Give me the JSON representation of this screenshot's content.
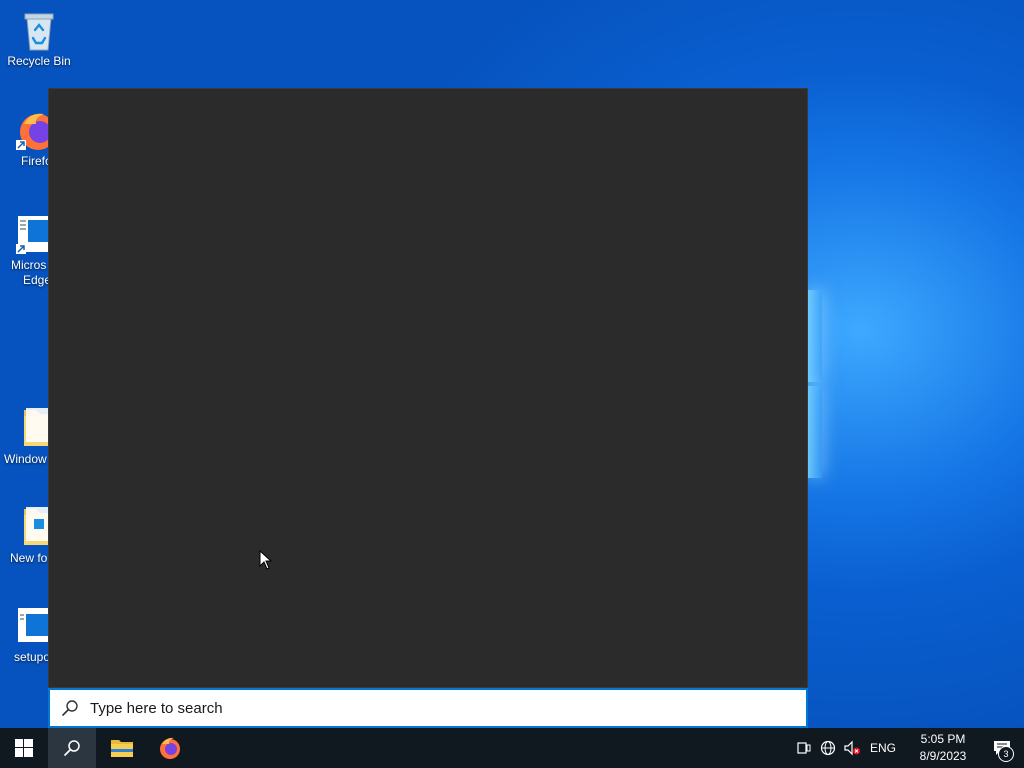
{
  "desktop": {
    "icons": [
      {
        "label": "Recycle Bin",
        "icon": "recycle-bin-icon"
      },
      {
        "label": "Firefo",
        "icon": "firefox-icon"
      },
      {
        "label": "Micros\nEdge",
        "line1": "Micros",
        "line2": "Edge",
        "icon": "edge-shortcut-icon"
      },
      {
        "label": "Window",
        "icon": "folder-icon"
      },
      {
        "label": "New fo",
        "icon": "folder-icon"
      },
      {
        "label": "setupo",
        "icon": "setup-icon"
      }
    ]
  },
  "search": {
    "placeholder": "Type here to search"
  },
  "taskbar": {
    "buttons": [
      {
        "name": "start",
        "icon": "windows-logo-icon"
      },
      {
        "name": "search",
        "icon": "search-icon"
      },
      {
        "name": "file-explorer",
        "icon": "folder-icon"
      },
      {
        "name": "firefox",
        "icon": "firefox-icon"
      }
    ],
    "tray": {
      "language": "ENG",
      "time": "5:05 PM",
      "date": "8/9/2023",
      "notification_count": "3"
    }
  },
  "colors": {
    "panel_bg": "#2b2b2b",
    "taskbar_bg": "#101820",
    "accent": "#0078d7"
  }
}
